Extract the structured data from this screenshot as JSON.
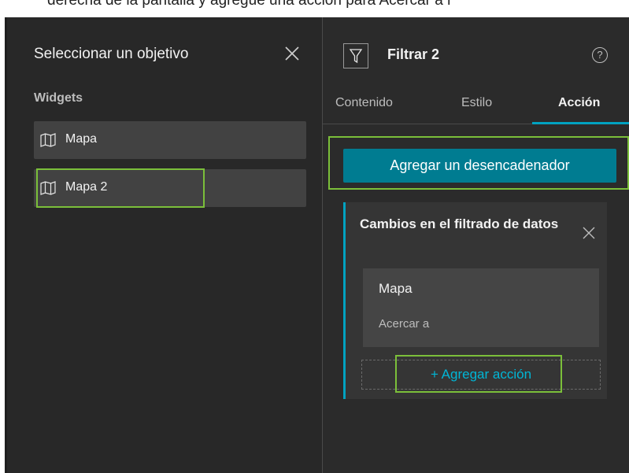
{
  "caption": {
    "text": "derecha de la pantalla y agregue una acción para Acercar a l"
  },
  "left_panel": {
    "title": "Seleccionar un objetivo",
    "section_label": "Widgets",
    "items": [
      {
        "label": "Mapa",
        "icon": "map-icon"
      },
      {
        "label": "Mapa 2",
        "icon": "map-icon"
      }
    ]
  },
  "right_panel": {
    "title": "Filtrar 2",
    "header_icon": "filter-icon",
    "help_icon": "?",
    "tabs": [
      {
        "label": "Contenido"
      },
      {
        "label": "Estilo"
      },
      {
        "label": "Acción",
        "active": true
      }
    ],
    "add_trigger_label": "Agregar un desencadenador",
    "trigger": {
      "title": "Cambios en el filtrado de datos",
      "target": "Mapa",
      "action": "Acercar a",
      "add_action_label": "+ Agregar acción"
    }
  },
  "colors": {
    "highlight": "#7bbf3a",
    "accent": "#00a2c0",
    "button": "#007c91"
  }
}
